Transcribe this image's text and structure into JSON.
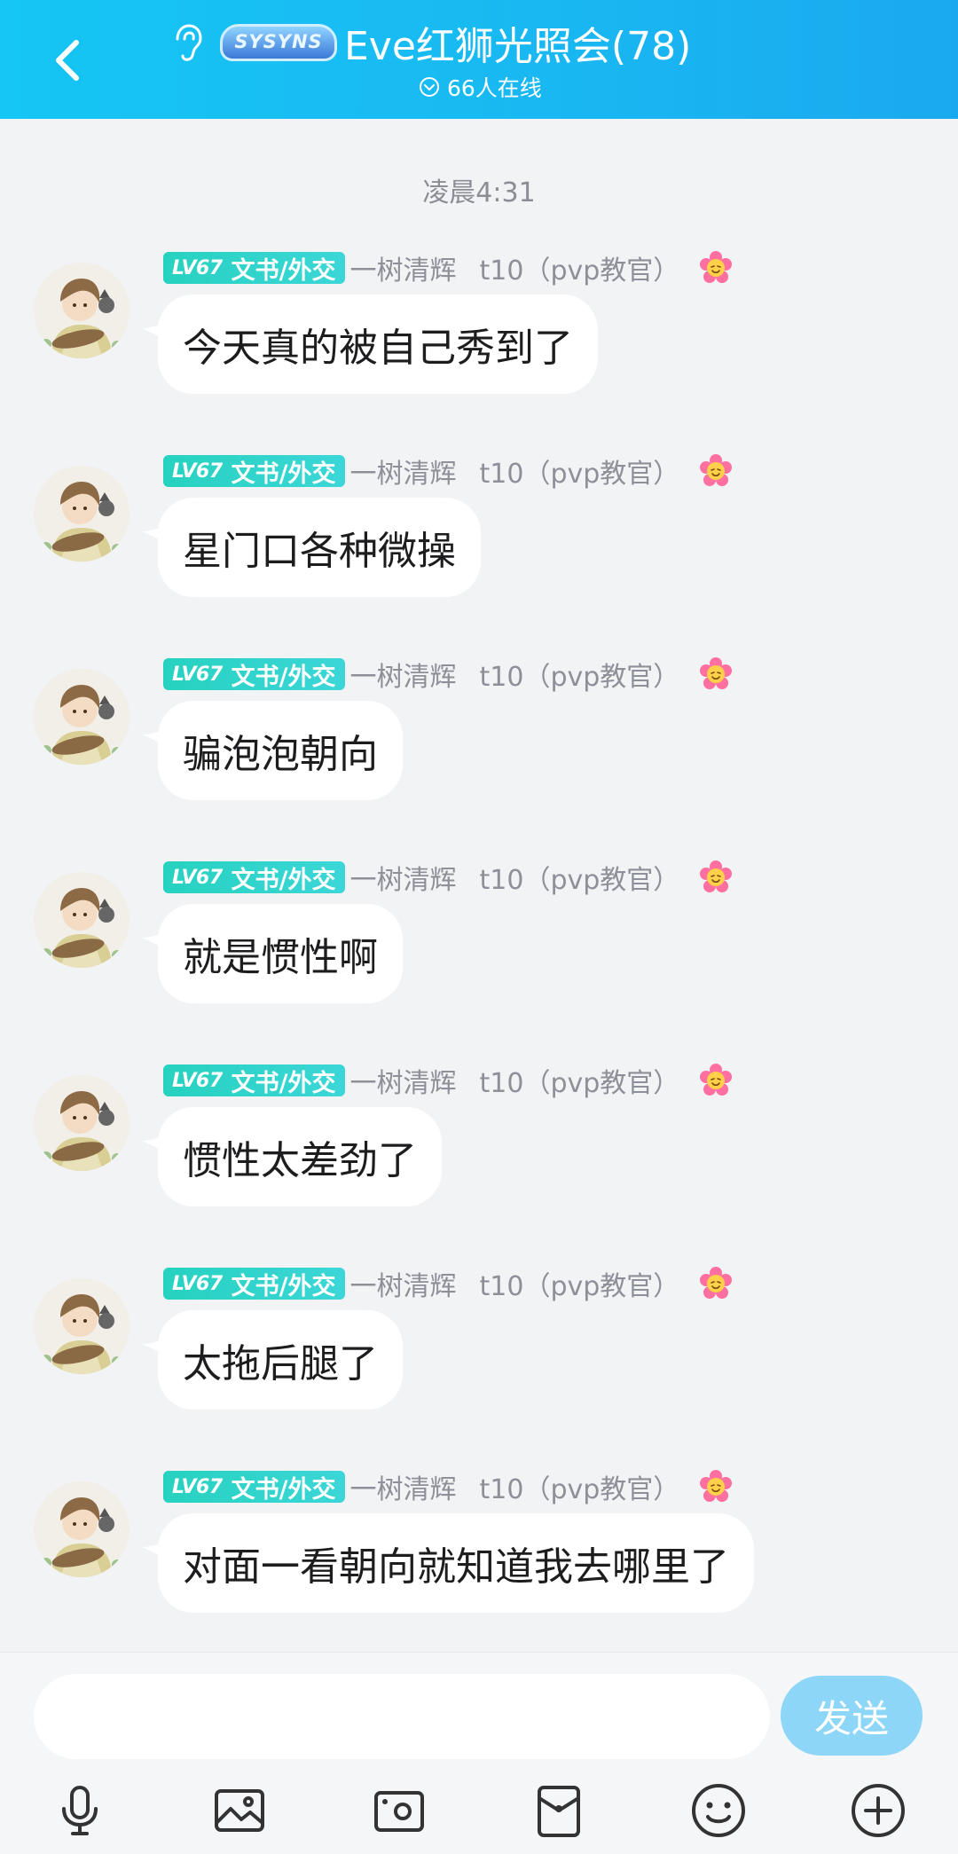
{
  "header": {
    "group_name": "Eve红狮光照会(78)",
    "online": "66人在线",
    "badge_text": "SYSYNS"
  },
  "timestamp": "凌晨4:31",
  "sender": {
    "level": "LV67",
    "tag": "文书/外交",
    "nick": "一树清辉",
    "title": "t10（pvp教官）"
  },
  "messages": [
    {
      "text": "今天真的被自己秀到了"
    },
    {
      "text": "星门口各种微操"
    },
    {
      "text": "骗泡泡朝向"
    },
    {
      "text": "就是惯性啊"
    },
    {
      "text": "惯性太差劲了"
    },
    {
      "text": "太拖后腿了"
    },
    {
      "text": "对面一看朝向就知道我去哪里了"
    }
  ],
  "composer": {
    "input_value": "",
    "send_label": "发送"
  },
  "toolbar": [
    "microphone-icon",
    "image-icon",
    "camera-icon",
    "red-packet-icon",
    "emoji-icon",
    "plus-icon"
  ],
  "colors": {
    "header": "#19b7f2",
    "tag": "#2dd4c8",
    "send": "#8dd6f8"
  }
}
